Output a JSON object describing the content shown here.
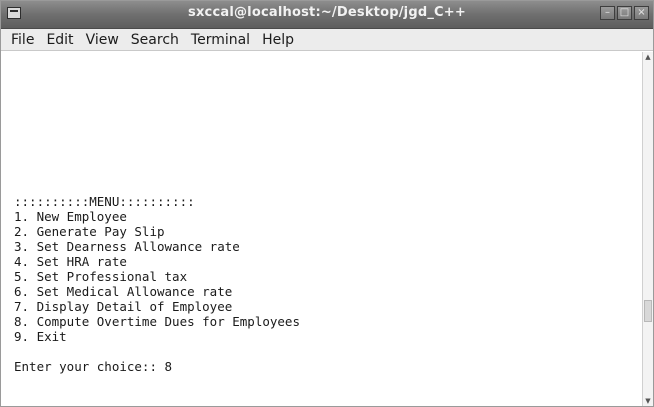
{
  "window": {
    "title": "sxccal@localhost:~/Desktop/jgd_C++",
    "controls": [
      "minimize",
      "maximize",
      "close"
    ]
  },
  "menubar": {
    "items": [
      "File",
      "Edit",
      "View",
      "Search",
      "Terminal",
      "Help"
    ]
  },
  "terminal": {
    "menu_header": "::::::::::MENU::::::::::",
    "options": [
      "1. New Employee",
      "2. Generate Pay Slip",
      "3. Set Dearness Allowance rate",
      "4. Set HRA rate",
      "5. Set Professional tax",
      "6. Set Medical Allowance rate",
      "7. Display Detail of Employee",
      "8. Compute Overtime Dues for Employees",
      "9. Exit"
    ],
    "prompt": "Enter your choice:: 8"
  },
  "icons": {
    "app": "terminal-app-icon",
    "minimize": "minimize-icon",
    "maximize": "maximize-icon",
    "close": "close-icon",
    "scroll_up": "scroll-up-arrow-icon",
    "scroll_down": "scroll-down-arrow-icon"
  }
}
